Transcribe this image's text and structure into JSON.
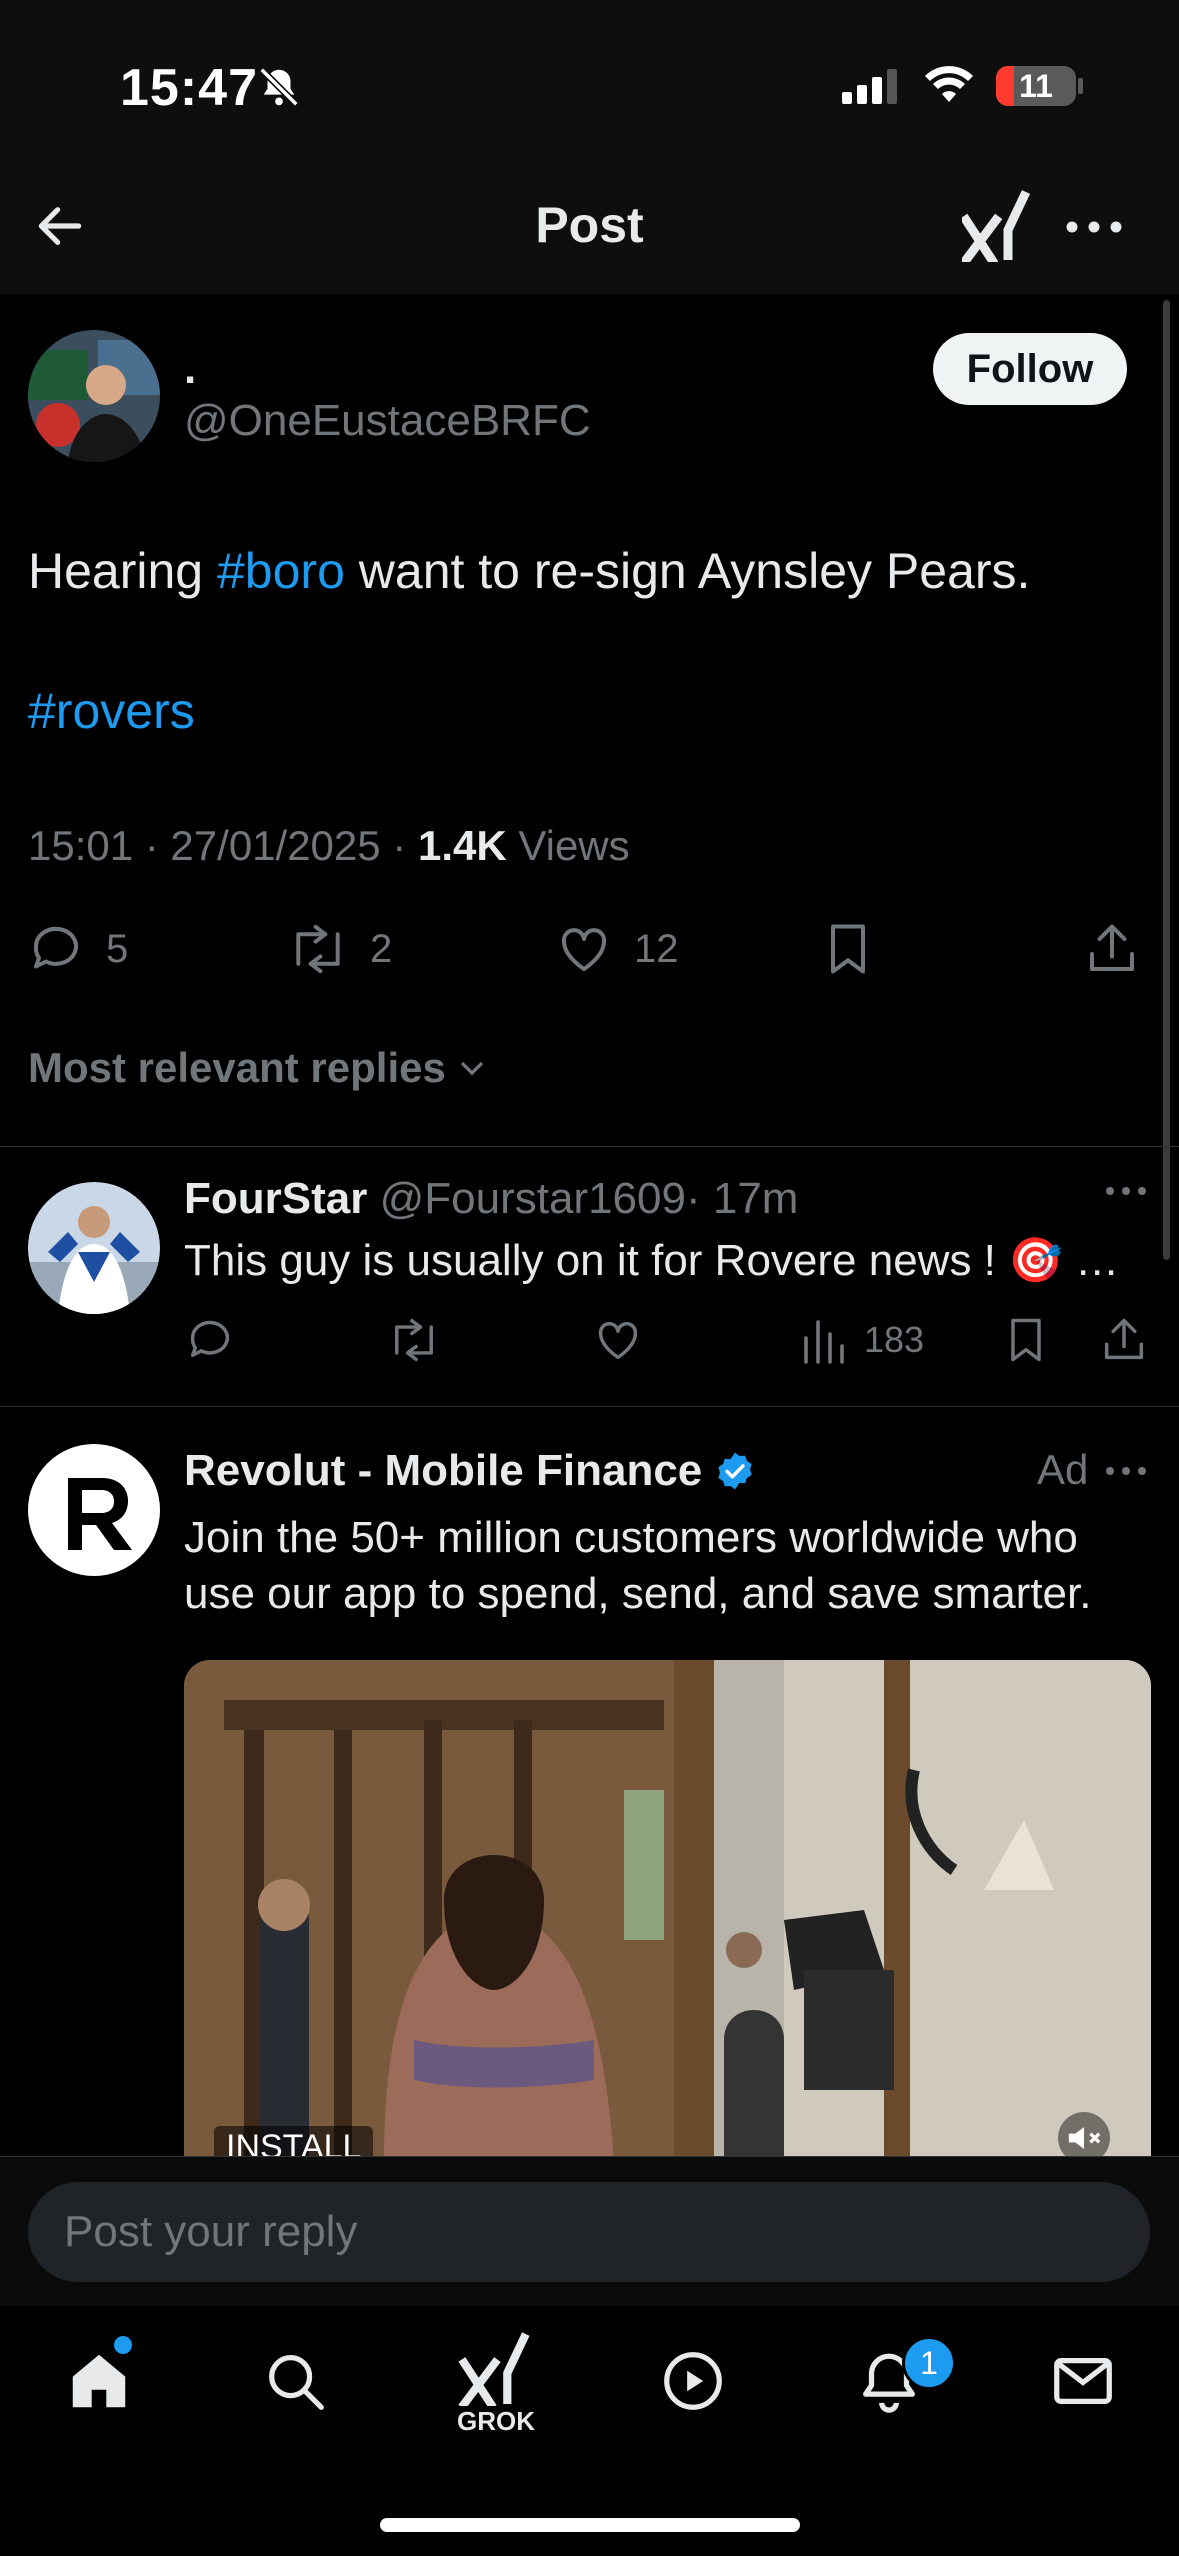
{
  "status_bar": {
    "time": "15:47",
    "battery_level": "11"
  },
  "header": {
    "title": "Post"
  },
  "post": {
    "author_name": ".",
    "author_handle": "@OneEustaceBRFC",
    "follow_label": "Follow",
    "text_before": "Hearing ",
    "hashtag_1": "#boro",
    "text_after": " want to re-sign Aynsley Pears.",
    "hashtag_2": "#rovers",
    "timestamp": "15:01 · 27/01/2025 · ",
    "views_count": "1.4K",
    "views_label": " Views",
    "replies": "5",
    "reposts": "2",
    "likes": "12"
  },
  "replies_filter": {
    "label": "Most relevant replies"
  },
  "reply": {
    "name": "FourStar",
    "handle": "@Fourstar1609",
    "time": "· 17m",
    "text": "This guy is usually on it for Rovere news !  🎯 …",
    "views": "183"
  },
  "ad": {
    "name": "Revolut - Mobile Finance",
    "label": "Ad",
    "text": "Join the 50+ million customers worldwide who use our app to spend, send, and save smarter.",
    "install_label": "INSTALL"
  },
  "reply_input": {
    "placeholder": "Post your reply"
  },
  "tabbar": {
    "grok_label": "GROK",
    "notification_count": "1"
  },
  "colors": {
    "accent": "#1d9bf0",
    "muted": "#71767b",
    "background": "#000000"
  }
}
